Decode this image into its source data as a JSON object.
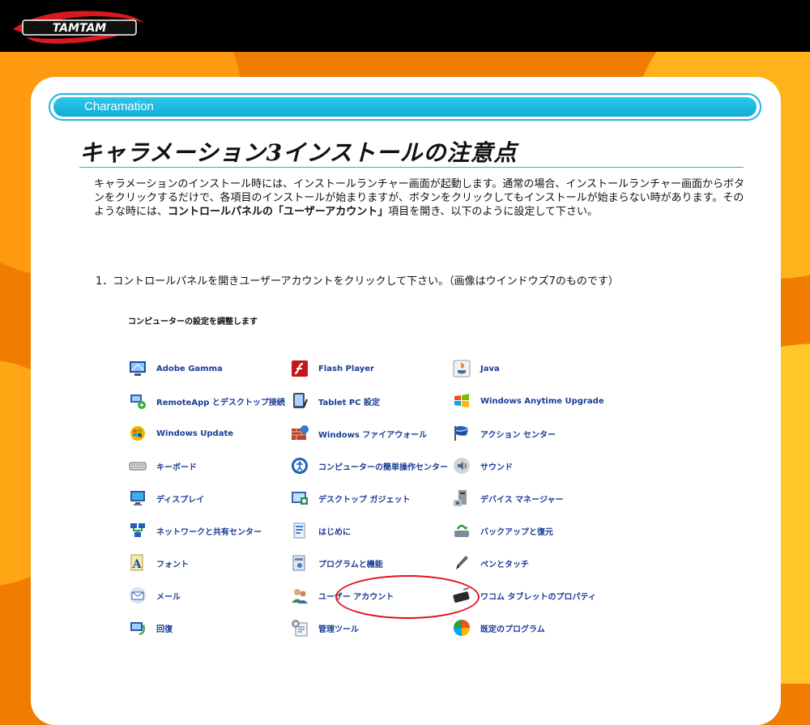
{
  "header": {
    "logo_text": "TAMTAM"
  },
  "section": {
    "label": "Charamation"
  },
  "page_title": "キャラメーション3インストールの注意点",
  "intro": {
    "part1": "キャラメーションのインストール時には、インストールランチャー画面が起動します。通常の場合、インストールランチャー画面からボタンをクリックするだけで、各項目のインストールが始まりますが、ボタンをクリックしてもインストールが始まらない時があります。そのような時には、",
    "bold": "コントロールパネルの「ユーザーアカウント」",
    "part2": "項目を開き、以下のように設定して下さい。"
  },
  "step1": "1．コントロールパネルを開きユーザーアカウントをクリックして下さい。（画像はウインドウズ7のものです）",
  "control_panel": {
    "heading": "コンピューターの設定を調整します",
    "items": [
      {
        "label": "Adobe Gamma",
        "icon": "monitor-icon"
      },
      {
        "label": "Flash Player",
        "icon": "flash-icon"
      },
      {
        "label": "Java",
        "icon": "java-icon"
      },
      {
        "label": "RemoteApp とデスクトップ接続",
        "icon": "remote-icon"
      },
      {
        "label": "Tablet PC 設定",
        "icon": "tablet-icon"
      },
      {
        "label": "Windows Anytime Upgrade",
        "icon": "windows-flag-icon"
      },
      {
        "label": "Windows Update",
        "icon": "update-icon"
      },
      {
        "label": "Windows ファイアウォール",
        "icon": "firewall-icon"
      },
      {
        "label": "アクション センター",
        "icon": "flag-icon"
      },
      {
        "label": "キーボード",
        "icon": "keyboard-icon"
      },
      {
        "label": "コンピューターの簡単操作センター",
        "icon": "accessibility-icon"
      },
      {
        "label": "サウンド",
        "icon": "speaker-icon"
      },
      {
        "label": "ディスプレイ",
        "icon": "display-icon"
      },
      {
        "label": "デスクトップ ガジェット",
        "icon": "gadget-icon"
      },
      {
        "label": "デバイス マネージャー",
        "icon": "device-manager-icon"
      },
      {
        "label": "ネットワークと共有センター",
        "icon": "network-icon"
      },
      {
        "label": "はじめに",
        "icon": "getting-started-icon"
      },
      {
        "label": "バックアップと復元",
        "icon": "backup-icon"
      },
      {
        "label": "フォント",
        "icon": "font-icon"
      },
      {
        "label": "プログラムと機能",
        "icon": "programs-icon"
      },
      {
        "label": "ペンとタッチ",
        "icon": "pen-icon"
      },
      {
        "label": "メール",
        "icon": "mail-icon"
      },
      {
        "label": "ユーザー アカウント",
        "icon": "user-accounts-icon"
      },
      {
        "label": "ワコム タブレットのプロパティ",
        "icon": "wacom-tablet-icon"
      },
      {
        "label": "回復",
        "icon": "recovery-icon"
      },
      {
        "label": "管理ツール",
        "icon": "admin-tools-icon"
      },
      {
        "label": "既定のプログラム",
        "icon": "default-programs-icon"
      }
    ]
  },
  "colors": {
    "accent_blue": "#19b6df",
    "link_blue": "#1a3c96",
    "orange": "#f07d00",
    "highlight_red": "#e3121b"
  }
}
